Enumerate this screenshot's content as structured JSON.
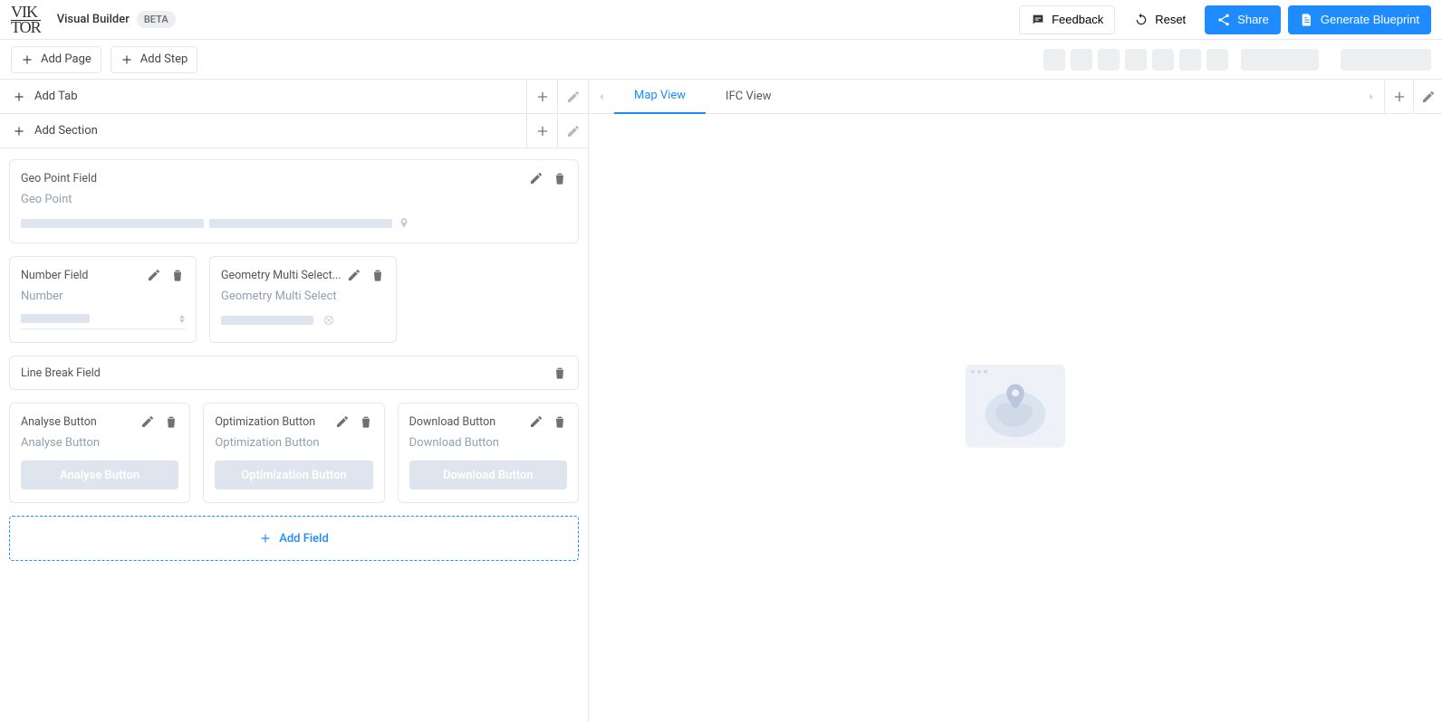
{
  "header": {
    "app_title": "Visual Builder",
    "beta_label": "BETA",
    "feedback_label": "Feedback",
    "reset_label": "Reset",
    "share_label": "Share",
    "generate_label": "Generate Blueprint"
  },
  "toolbar": {
    "add_page_label": "Add Page",
    "add_step_label": "Add Step"
  },
  "left_panel": {
    "add_tab_label": "Add Tab",
    "add_section_label": "Add Section",
    "add_field_label": "Add Field",
    "fields": {
      "geo_point": {
        "title": "Geo Point Field",
        "label": "Geo Point"
      },
      "number": {
        "title": "Number Field",
        "label": "Number"
      },
      "geometry_multi": {
        "title": "Geometry Multi Select...",
        "label": "Geometry Multi Select"
      },
      "line_break": {
        "title": "Line Break Field"
      },
      "analyse_btn": {
        "title": "Analyse Button",
        "label": "Analyse Button",
        "button_text": "Analyse Button"
      },
      "optimization_btn": {
        "title": "Optimization Button",
        "label": "Optimization Button",
        "button_text": "Optimization Button"
      },
      "download_btn": {
        "title": "Download Button",
        "label": "Download Button",
        "button_text": "Download Button"
      }
    }
  },
  "right_panel": {
    "tabs": [
      {
        "label": "Map View",
        "active": true
      },
      {
        "label": "IFC View",
        "active": false
      }
    ]
  },
  "colors": {
    "primary": "#1e8bff",
    "muted": "#dfe5ee",
    "border": "#e5e7eb"
  }
}
